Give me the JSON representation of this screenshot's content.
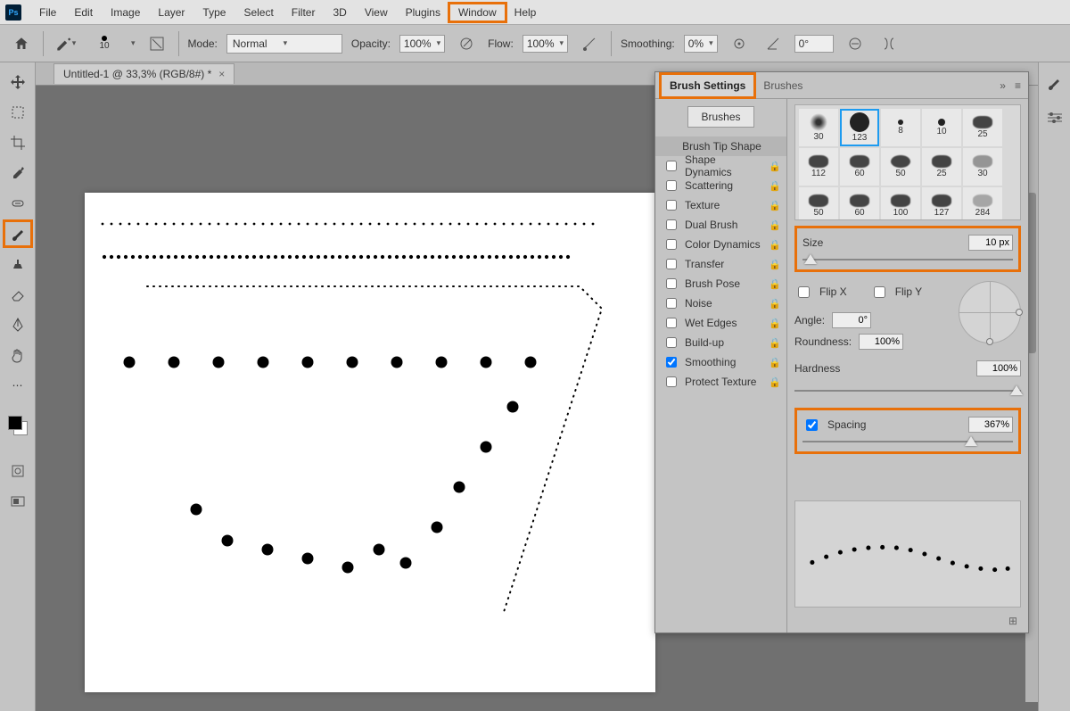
{
  "menubar": [
    "File",
    "Edit",
    "Image",
    "Layer",
    "Type",
    "Select",
    "Filter",
    "3D",
    "View",
    "Plugins",
    "Window",
    "Help"
  ],
  "optbar": {
    "brush_size_label": "10",
    "mode_label": "Mode:",
    "mode_value": "Normal",
    "opacity_label": "Opacity:",
    "opacity_value": "100%",
    "flow_label": "Flow:",
    "flow_value": "100%",
    "smoothing_label": "Smoothing:",
    "smoothing_value": "0%",
    "angle_value": "0°"
  },
  "doc_tab": "Untitled-1 @ 33,3% (RGB/8#) *",
  "panel": {
    "tab_brush_settings": "Brush Settings",
    "tab_brushes": "Brushes",
    "brushes_button": "Brushes",
    "rows": {
      "tip": "Brush Tip Shape",
      "shape": "Shape Dynamics",
      "scatter": "Scattering",
      "texture": "Texture",
      "dual": "Dual Brush",
      "color": "Color Dynamics",
      "transfer": "Transfer",
      "pose": "Brush Pose",
      "noise": "Noise",
      "wet": "Wet Edges",
      "build": "Build-up",
      "smoothing": "Smoothing",
      "protect": "Protect Texture"
    },
    "thumbs": [
      "30",
      "123",
      "8",
      "10",
      "25",
      "112",
      "60",
      "50",
      "25",
      "30",
      "50",
      "60",
      "100",
      "127",
      "284"
    ],
    "size_label": "Size",
    "size_value": "10 px",
    "flipx_label": "Flip X",
    "flipy_label": "Flip Y",
    "angle_label": "Angle:",
    "angle_value": "0°",
    "roundness_label": "Roundness:",
    "roundness_value": "100%",
    "hardness_label": "Hardness",
    "hardness_value": "100%",
    "spacing_label": "Spacing",
    "spacing_value": "367%"
  }
}
